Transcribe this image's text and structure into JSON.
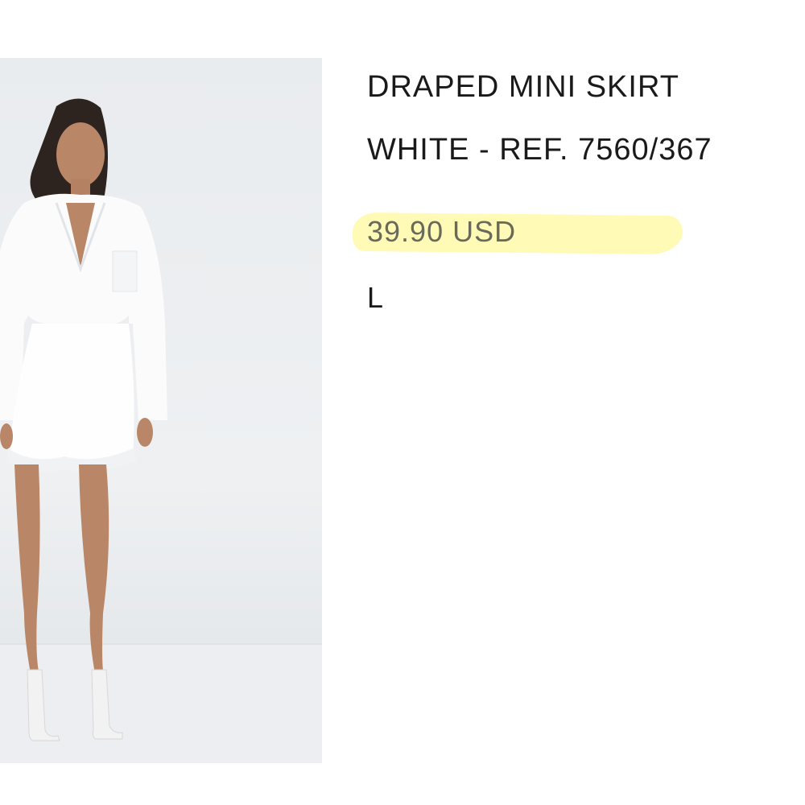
{
  "product": {
    "name": "DRAPED MINI SKIRT",
    "color_ref": "WHITE - REF. 7560/367",
    "price": "39.90 USD",
    "size": "L"
  },
  "photo": {
    "alt": "Model wearing white shirt and draped mini skirt"
  },
  "colors": {
    "highlight": "#fff678",
    "text": "#1a1a1a",
    "price_text": "#6a6a5a"
  }
}
